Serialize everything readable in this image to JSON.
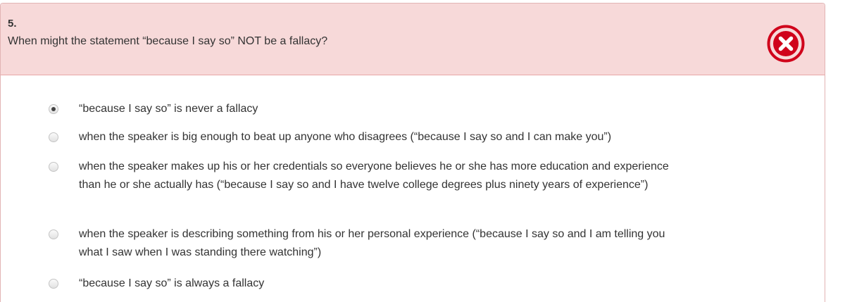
{
  "question": {
    "number": "5.",
    "text": "When might the statement “because I say so” NOT be a fallacy?",
    "status": "incorrect",
    "status_icon": "x-circle-icon",
    "status_color": "#d0021b"
  },
  "answers": [
    {
      "text": "“because I say so” is never a fallacy",
      "selected": true
    },
    {
      "text": "when the speaker is big enough to beat up anyone who disagrees (“because I say so and I can make you”)",
      "selected": false
    },
    {
      "text": "when the speaker makes up his or her credentials so everyone believes he or she has more education and experience than he or she actually has (“because I say so and I have twelve college degrees plus ninety years of experience”)",
      "selected": false
    },
    {
      "text": "when the speaker is describing something from his or her personal experience (“because I say so and I am telling you what I saw when I was standing there watching”)",
      "selected": false
    },
    {
      "text": "“because I say so” is always a fallacy",
      "selected": false
    }
  ]
}
